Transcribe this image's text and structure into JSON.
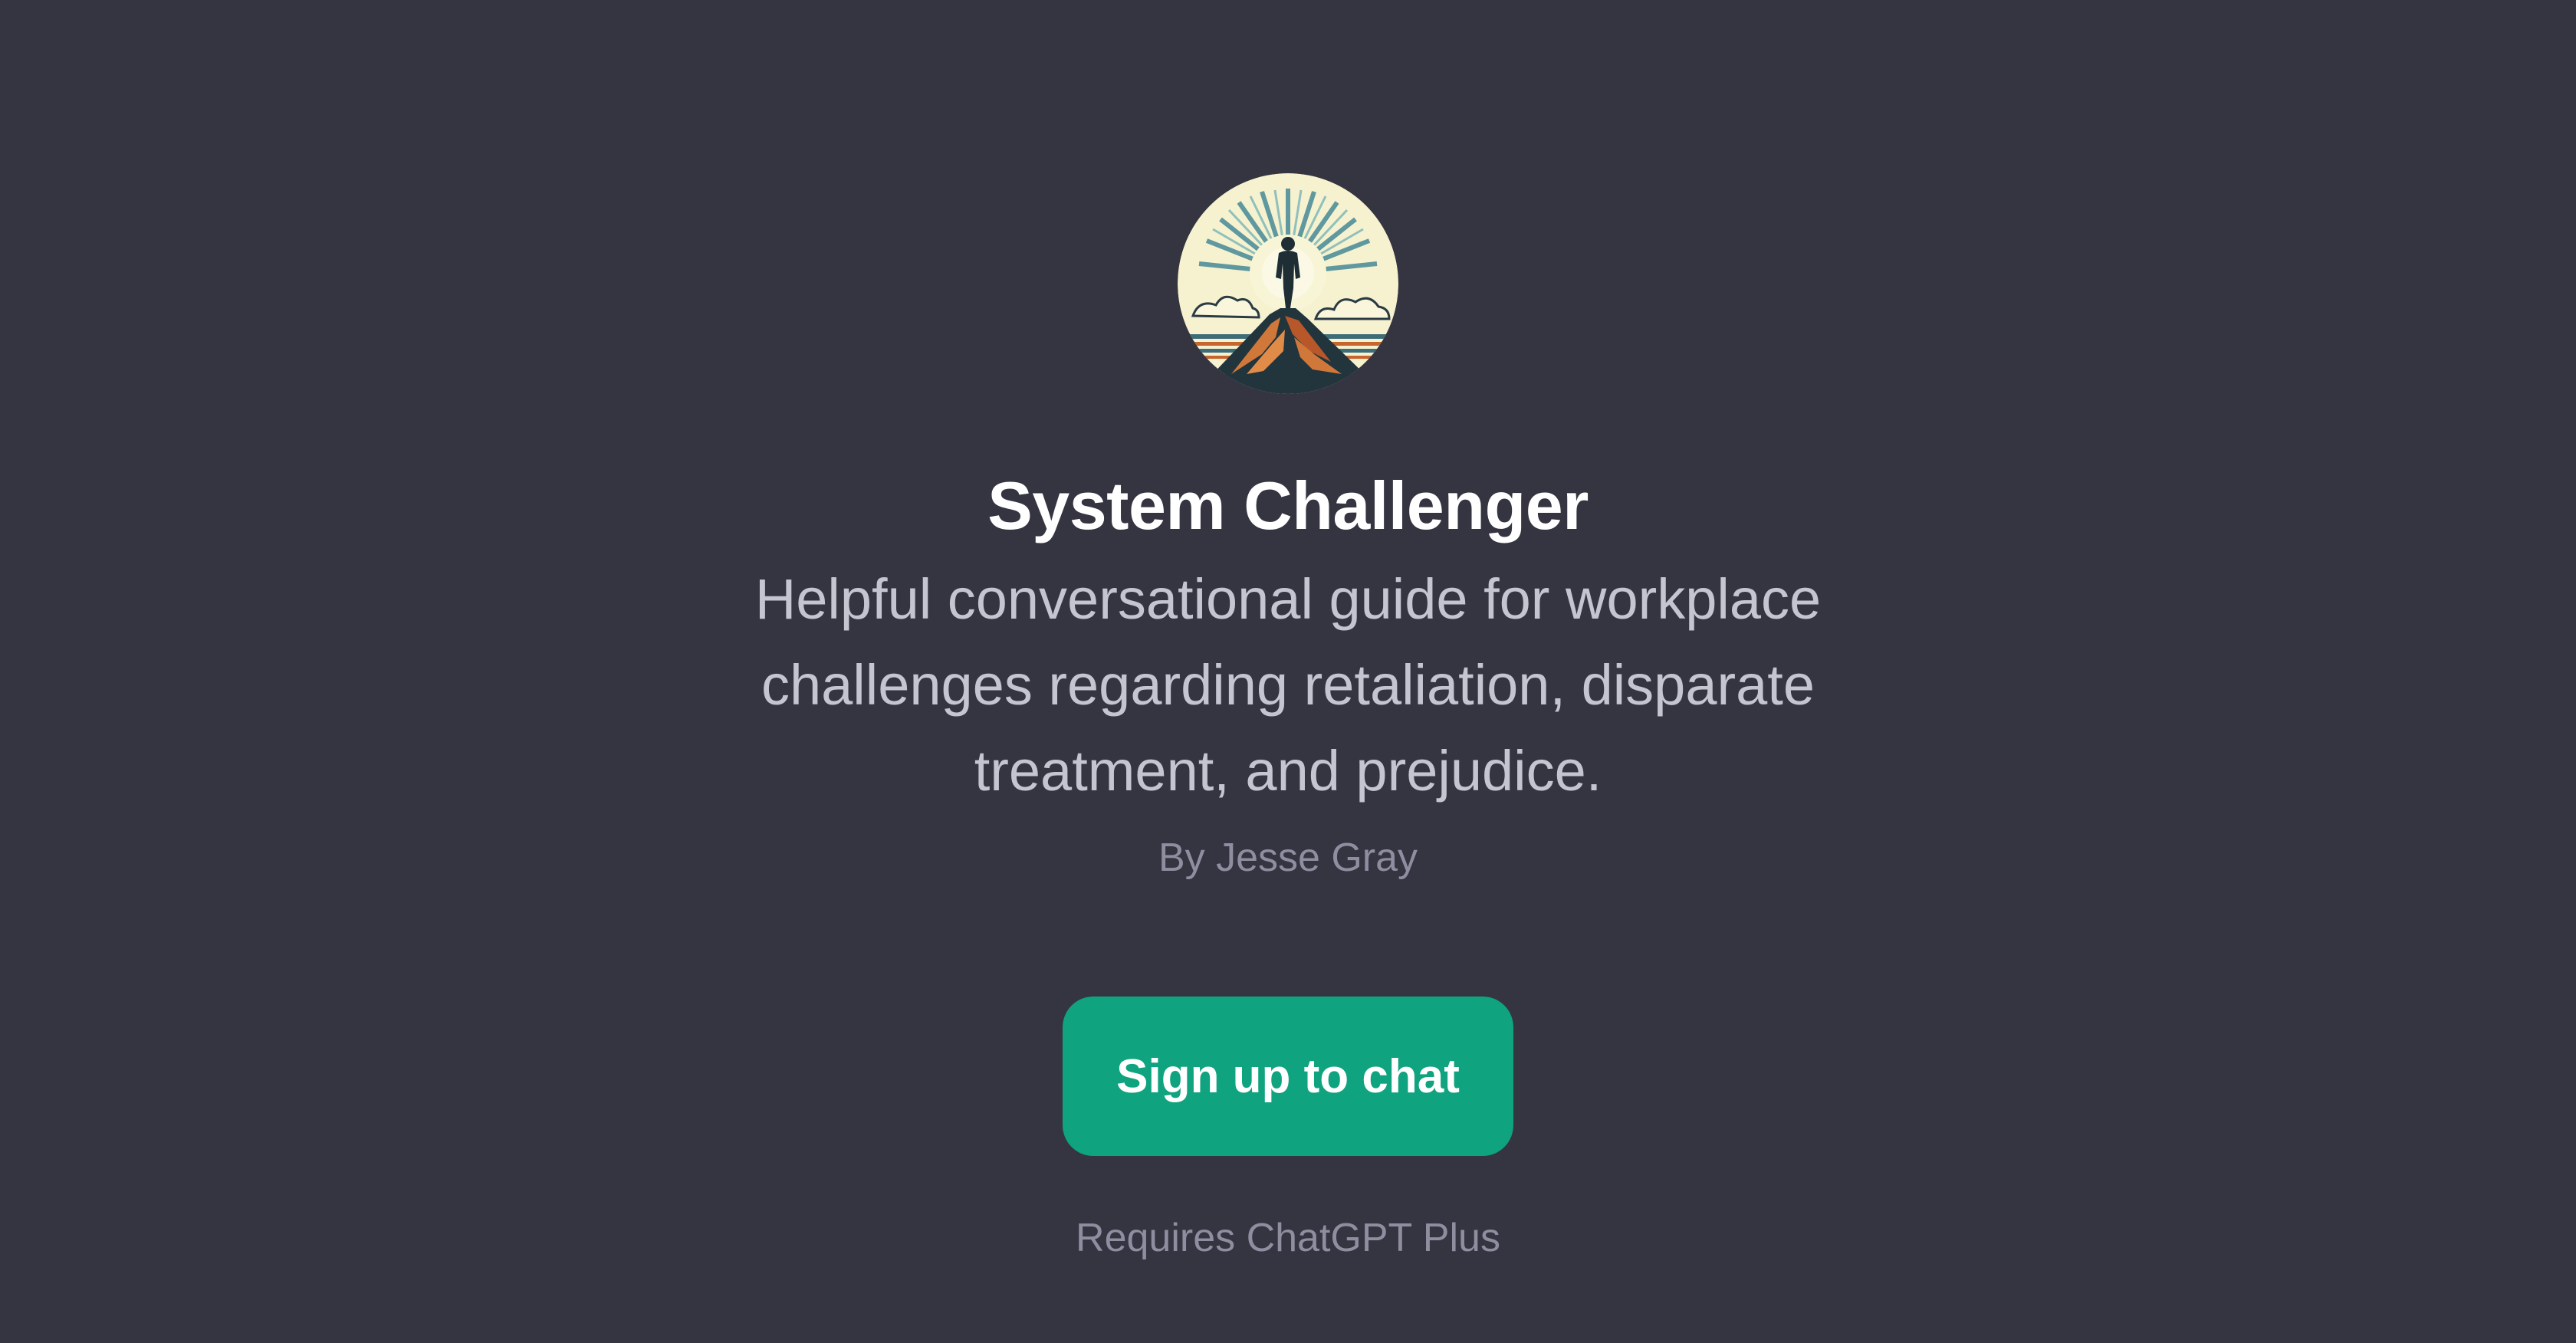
{
  "gpt": {
    "avatar_icon": "mountain-summit-figure-icon",
    "title": "System Challenger",
    "description": "Helpful conversational guide for workplace challenges regarding retaliation, disparate treatment, and prejudice.",
    "author": "By Jesse Gray"
  },
  "cta": {
    "label": "Sign up to chat",
    "note": "Requires ChatGPT Plus"
  },
  "colors": {
    "background": "#343541",
    "title": "#ffffff",
    "description": "#c5c5d2",
    "muted": "#8e8ea0",
    "accent": "#10a37f"
  }
}
